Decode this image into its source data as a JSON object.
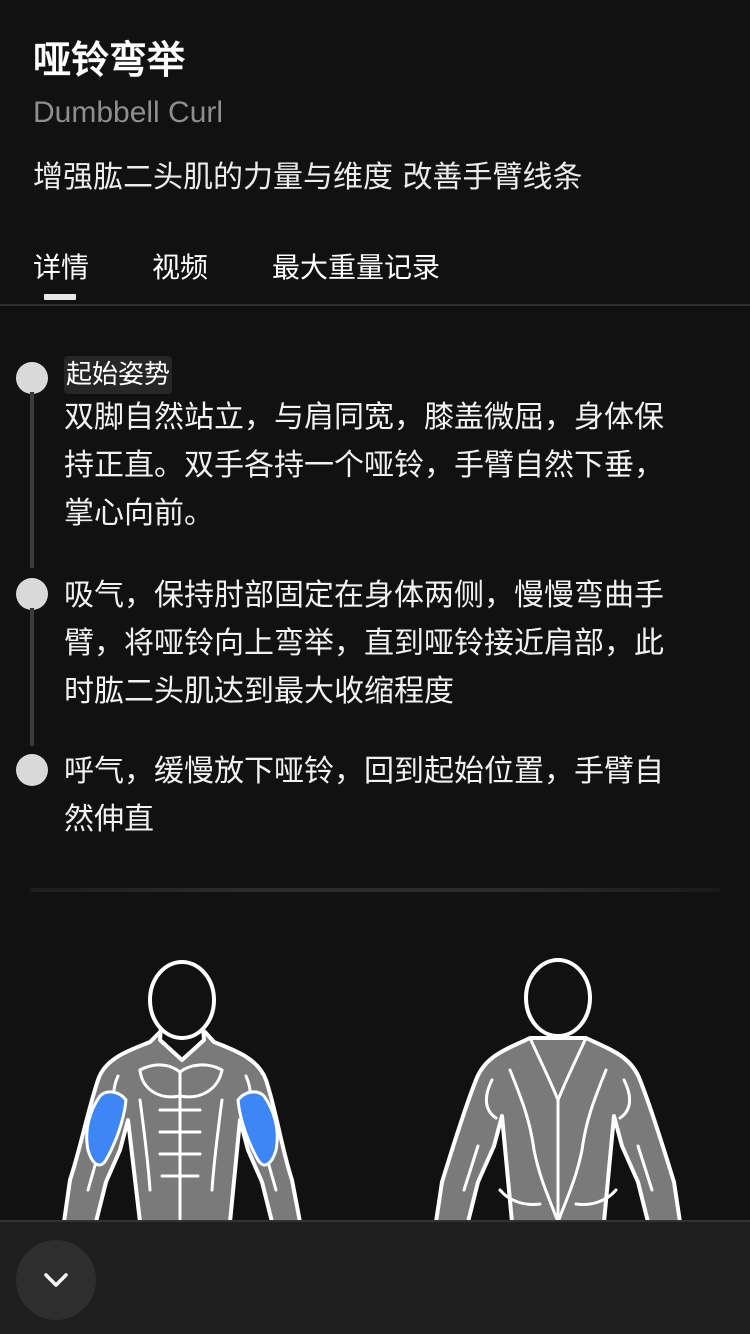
{
  "exercise": {
    "title": "哑铃弯举",
    "subtitle": "Dumbbell Curl",
    "description": "增强肱二头肌的力量与维度 改善手臂线条"
  },
  "tabs": [
    {
      "label": "详情",
      "active": true
    },
    {
      "label": "视频",
      "active": false
    },
    {
      "label": "最大重量记录",
      "active": false
    }
  ],
  "steps": [
    {
      "label": "起始姿势",
      "lines": [
        "双脚自然站立，与肩同宽，膝盖微屈，身体保",
        "持正直。双手各持一个哑铃，手臂自然下垂，",
        "掌心向前。"
      ]
    },
    {
      "label": "",
      "lines": [
        "吸气，保持肘部固定在身体两侧，慢慢弯曲手",
        "臂，将哑铃向上弯举，直到哑铃接近肩部，此",
        "时肱二头肌达到最大收缩程度"
      ]
    },
    {
      "label": "",
      "lines": [
        "呼气，缓慢放下哑铃，回到起始位置，手臂自",
        "然伸直"
      ]
    }
  ],
  "muscle_map": {
    "highlight_color": "#3d86f5",
    "muscle_color": "#7a7a7a",
    "outline_color": "#ffffff",
    "highlighted_muscles": [
      "biceps"
    ]
  },
  "icons": {
    "collapse": "chevron-down-icon"
  }
}
